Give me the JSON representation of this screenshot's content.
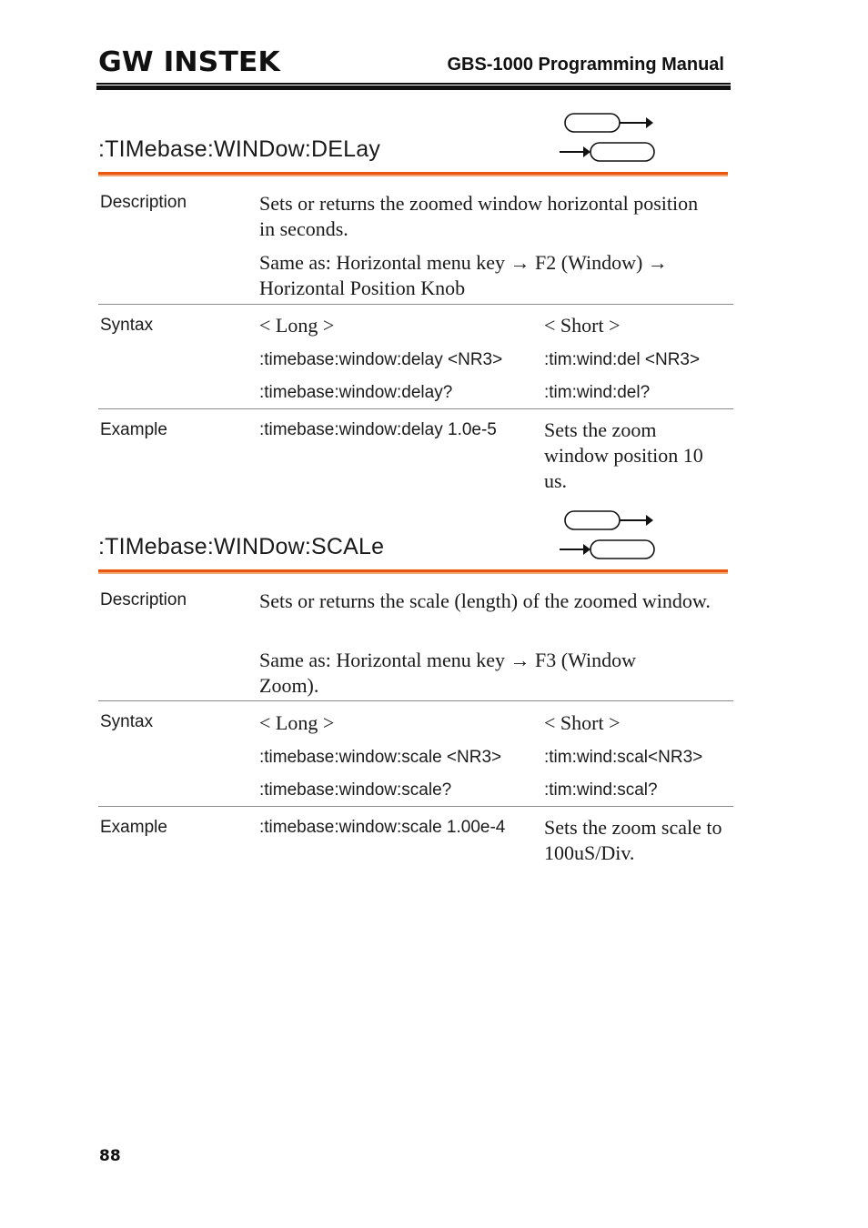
{
  "header": {
    "logo": "GW INSTEK",
    "manual_title": "GBS-1000 Programming Manual"
  },
  "sections": [
    {
      "command": ":TIMebase:WINDow:DELay",
      "icons": [
        "set-command-icon",
        "query-command-icon"
      ],
      "description_label": "Description",
      "description": "Sets or returns the zoomed window horizontal position in seconds.",
      "same_as": "Same as: Horizontal menu key → F2 (Window) → Horizontal Position Knob",
      "syntax_label": "Syntax",
      "syntax_long_header": "< Long >",
      "syntax_short_header": "< Short >",
      "syntax_rows": [
        {
          "long": ":timebase:window:delay <NR3>",
          "short": ":tim:wind:del <NR3>"
        },
        {
          "long": ":timebase:window:delay?",
          "short": ":tim:wind:del?"
        }
      ],
      "example_label": "Example",
      "example_command": ":timebase:window:delay 1.0e-5",
      "example_desc": "Sets the zoom window position 10 us."
    },
    {
      "command": ":TIMebase:WINDow:SCALe",
      "icons": [
        "set-command-icon",
        "query-command-icon"
      ],
      "description_label": "Description",
      "description": "Sets or returns the scale (length) of the zoomed window.",
      "same_as": "Same as: Horizontal menu key → F3 (Window Zoom).",
      "syntax_label": "Syntax",
      "syntax_long_header": "< Long >",
      "syntax_short_header": "< Short >",
      "syntax_rows": [
        {
          "long": ":timebase:window:scale <NR3>",
          "short": ":tim:wind:scal<NR3>"
        },
        {
          "long": ":timebase:window:scale?",
          "short": ":tim:wind:scal?"
        }
      ],
      "example_label": "Example",
      "example_command": ":timebase:window:scale 1.00e-4",
      "example_desc": "Sets the zoom scale to 100uS/Div."
    }
  ],
  "footer": {
    "page_number": "88"
  },
  "colors": {
    "accent_rule": "#e8560f",
    "text": "#1a1a1a"
  }
}
